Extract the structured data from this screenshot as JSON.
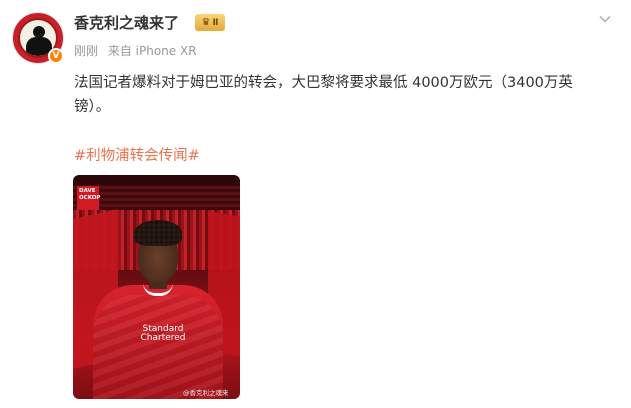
{
  "post": {
    "username": "香克利之魂来了",
    "badge_level": "Ⅱ",
    "timestamp": "刚刚",
    "source": "来自 iPhone XR",
    "text": "法国记者爆料对于姆巴亚的转会，大巴黎将要求最低 4000万欧元（3400万英镑）。",
    "hashtag": "#利物浦转会传闻#"
  },
  "image": {
    "corner_tag": "DAVE OCKOP",
    "sponsor_text": "Standard Chartered",
    "watermark": "@香克利之魂来"
  },
  "icons": {
    "verified": "verified-v-icon",
    "badge": "crown-icon",
    "menu": "chevron-down-icon"
  },
  "colors": {
    "accent": "#eb7350",
    "verified": "#ff8200",
    "liverpool_red": "#c8102e"
  }
}
